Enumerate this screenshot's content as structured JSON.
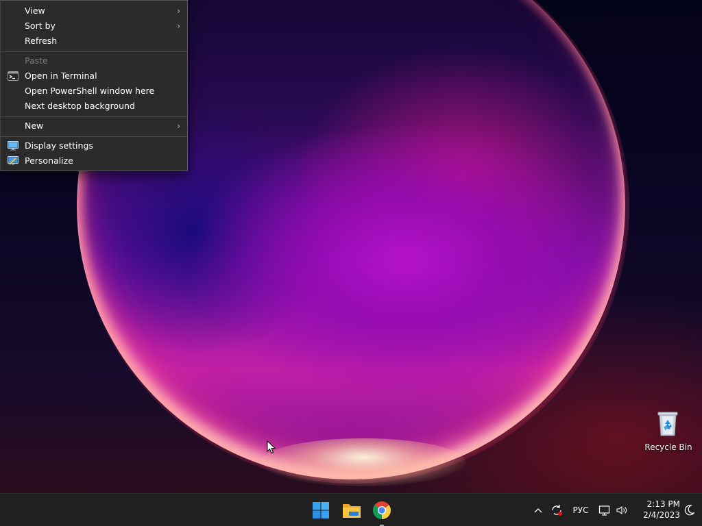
{
  "context_menu": {
    "items": [
      {
        "id": "view",
        "label": "View",
        "has_submenu": true,
        "disabled": false
      },
      {
        "id": "sort-by",
        "label": "Sort by",
        "has_submenu": true,
        "disabled": false
      },
      {
        "id": "refresh",
        "label": "Refresh",
        "has_submenu": false,
        "disabled": false
      },
      {
        "id": "paste",
        "label": "Paste",
        "has_submenu": false,
        "disabled": true
      },
      {
        "id": "open-terminal",
        "label": "Open in Terminal",
        "icon": "terminal-icon"
      },
      {
        "id": "open-powershell",
        "label": "Open PowerShell window here"
      },
      {
        "id": "next-background",
        "label": "Next desktop background"
      },
      {
        "id": "new",
        "label": "New",
        "has_submenu": true
      },
      {
        "id": "display-settings",
        "label": "Display settings",
        "icon": "display-settings-icon"
      },
      {
        "id": "personalize",
        "label": "Personalize",
        "icon": "personalize-icon"
      }
    ]
  },
  "desktop": {
    "recycle_bin_label": "Recycle Bin"
  },
  "taskbar": {
    "apps": [
      {
        "name": "Start",
        "icon": "windows-logo-icon"
      },
      {
        "name": "File Explorer",
        "icon": "folder-icon"
      },
      {
        "name": "Google Chrome",
        "icon": "chrome-icon",
        "running": true
      }
    ],
    "tray": {
      "language": "РУС",
      "time": "2:13 PM",
      "date": "2/4/2023"
    }
  },
  "colors": {
    "menu_bg": "#2b2b2b",
    "taskbar_bg": "#202020",
    "start_blue": "#3aa0f0",
    "folder_yellow": "#f6c544"
  }
}
